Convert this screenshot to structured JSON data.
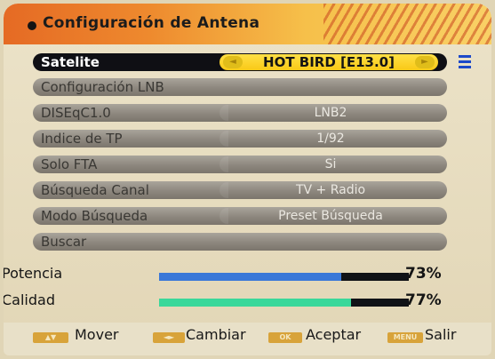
{
  "header": {
    "title": "Configuración de Antena"
  },
  "menu": {
    "selected": {
      "label": "Satelite",
      "value": "HOT BIRD [E13.0]",
      "left_arrow": "◄",
      "right_arrow": "►"
    },
    "rows": [
      {
        "label": "Configuración LNB",
        "value": ""
      },
      {
        "label": "DISEqC1.0",
        "value": "LNB2"
      },
      {
        "label": "Indice de TP",
        "value": "1/92"
      },
      {
        "label": "Solo FTA",
        "value": "Si"
      },
      {
        "label": "Búsqueda Canal",
        "value": "TV + Radio"
      },
      {
        "label": "Modo Búsqueda",
        "value": "Preset Búsqueda"
      },
      {
        "label": "Buscar",
        "value": ""
      }
    ]
  },
  "signal": {
    "potencia": {
      "label": "Potencia",
      "percent_text": "73%",
      "level": 0.73,
      "color": "#3a78d8"
    },
    "calidad": {
      "label": "Calidad",
      "percent_text": "77%",
      "level": 0.77,
      "color": "#3ad89a"
    }
  },
  "footer": {
    "keys": [
      {
        "icon": "up-down-arrows-icon",
        "key_text": "▲▼",
        "label": "Mover"
      },
      {
        "icon": "left-right-arrows-icon",
        "key_text": "◄►",
        "label": "Cambiar"
      },
      {
        "icon": "ok-key-icon",
        "key_text": "OK",
        "label": "Aceptar"
      },
      {
        "icon": "menu-key-icon",
        "key_text": "MENU",
        "label": "Salir"
      }
    ]
  },
  "colors": {
    "header_start": "#e56a24",
    "header_end": "#f9d066",
    "selection": "#ffe046",
    "key": "#d8a33a",
    "menu_icon": "#1d49c9"
  }
}
